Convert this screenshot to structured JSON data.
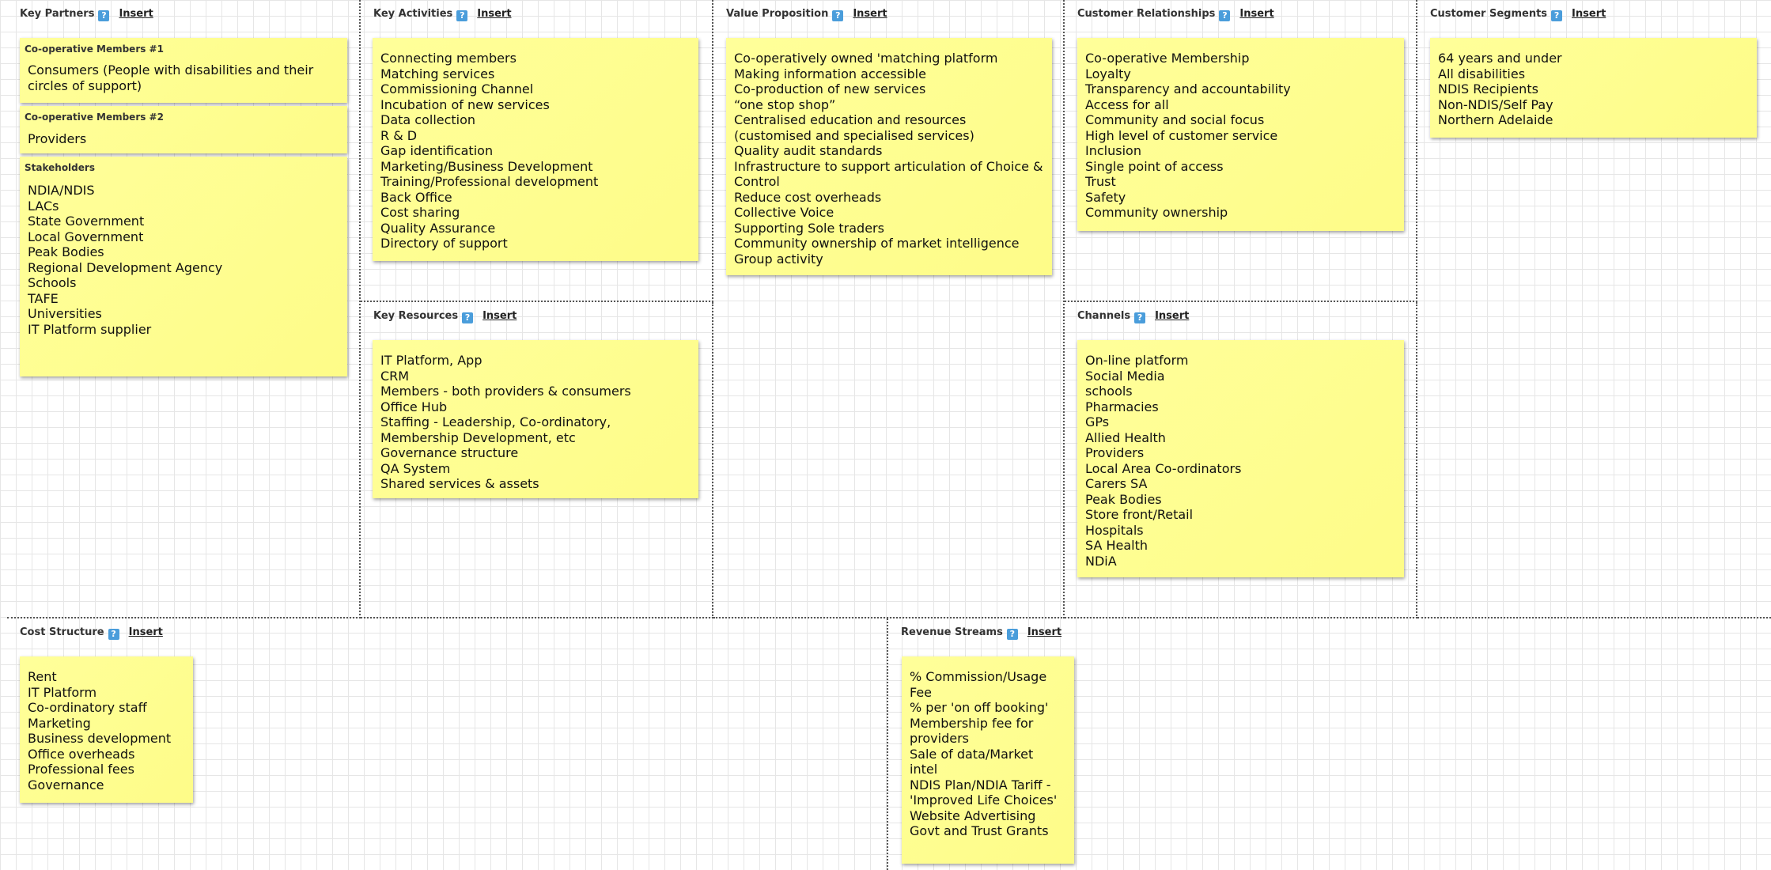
{
  "sections": {
    "key_partners": {
      "title": "Key Partners",
      "help": "?",
      "insert": "Insert",
      "notes": [
        {
          "label": "Co-operative Members #1",
          "text": "Consumers (People with disabilities and their\ncircles of support)"
        },
        {
          "label": "Co-operative Members #2",
          "text": "Providers"
        },
        {
          "label": "Stakeholders",
          "text": "NDIA/NDIS\nLACs\nState Government\nLocal Government\nPeak Bodies\nRegional Development Agency\nSchools\nTAFE\nUniversities\nIT Platform supplier"
        }
      ]
    },
    "key_activities": {
      "title": "Key Activities",
      "help": "?",
      "insert": "Insert",
      "text": "Connecting members\nMatching services\nCommissioning Channel\nIncubation of new services\nData collection\nR & D\nGap identification\nMarketing/Business Development\nTraining/Professional development\nBack Office\nCost sharing\nQuality Assurance\nDirectory of support"
    },
    "key_resources": {
      "title": "Key Resources",
      "help": "?",
      "insert": "Insert",
      "text": "IT Platform, App\nCRM\nMembers - both providers & consumers\nOffice Hub\nStaffing - Leadership, Co-ordinatory,\nMembership Development, etc\nGovernance structure\nQA System\nShared services & assets"
    },
    "value_proposition": {
      "title": "Value Proposition",
      "help": "?",
      "insert": "Insert",
      "text": "Co-operatively owned 'matching platform\nMaking information accessible\nCo-production of new services\n“one stop shop”\nCentralised education and resources\n(customised and specialised services)\nQuality audit standards\nInfrastructure to support articulation of Choice &\nControl\nReduce cost overheads\nCollective Voice\nSupporting Sole traders\nCommunity ownership of market intelligence\nGroup activity"
    },
    "customer_relationships": {
      "title": "Customer Relationships",
      "help": "?",
      "insert": "Insert",
      "text": "Co-operative Membership\nLoyalty\nTransparency and accountability\nAccess for all\nCommunity and social focus\nHigh level of customer service\nInclusion\nSingle point of access\nTrust\nSafety\nCommunity ownership"
    },
    "channels": {
      "title": "Channels",
      "help": "?",
      "insert": "Insert",
      "text": "On-line platform\nSocial Media\nschools\nPharmacies\nGPs\nAllied Health\nProviders\nLocal Area Co-ordinators\nCarers SA\nPeak Bodies\nStore front/Retail\nHospitals\nSA Health\nNDiA"
    },
    "customer_segments": {
      "title": "Customer Segments",
      "help": "?",
      "insert": "Insert",
      "text": "64 years and under\nAll disabilities\nNDIS Recipients\nNon-NDIS/Self Pay\nNorthern Adelaide"
    },
    "cost_structure": {
      "title": "Cost Structure",
      "help": "?",
      "insert": "Insert",
      "text": "Rent\nIT Platform\nCo-ordinatory staff\nMarketing\nBusiness development\nOffice overheads\nProfessional fees\nGovernance"
    },
    "revenue_streams": {
      "title": "Revenue Streams",
      "help": "?",
      "insert": "Insert",
      "text": "% Commission/Usage\nFee\n% per 'on off booking'\nMembership fee for\nproviders\nSale of data/Market\nintel\nNDIS Plan/NDIA Tariff -\n'Improved Life Choices'\nWebsite Advertising\nGovt and Trust Grants"
    }
  }
}
